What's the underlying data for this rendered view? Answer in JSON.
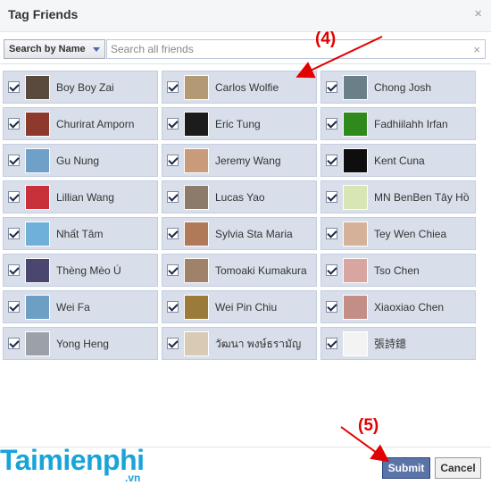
{
  "dialog": {
    "title": "Tag Friends",
    "close": "×"
  },
  "search": {
    "filter_label": "Search by Name",
    "placeholder": "Search all friends",
    "clear": "×"
  },
  "friends": [
    {
      "name": "Boy Boy Zai",
      "checked": true,
      "avatar_color": "#5a4a3e"
    },
    {
      "name": "Carlos Wolfie",
      "checked": true,
      "avatar_color": "#b49a74"
    },
    {
      "name": "Chong Josh",
      "checked": true,
      "avatar_color": "#6b7f88"
    },
    {
      "name": "Churirat Amporn",
      "checked": true,
      "avatar_color": "#8d3a2c"
    },
    {
      "name": "Eric Tung",
      "checked": true,
      "avatar_color": "#1c1c1c"
    },
    {
      "name": "Fadhiilahh Irfan",
      "checked": true,
      "avatar_color": "#2f8a1c"
    },
    {
      "name": "Gu Nung",
      "checked": true,
      "avatar_color": "#6ea0c8"
    },
    {
      "name": "Jeremy Wang",
      "checked": true,
      "avatar_color": "#c99b7a"
    },
    {
      "name": "Kent Cuna",
      "checked": true,
      "avatar_color": "#0e0e0e"
    },
    {
      "name": "Lillian Wang",
      "checked": true,
      "avatar_color": "#c8303a"
    },
    {
      "name": "Lucas Yao",
      "checked": true,
      "avatar_color": "#8c7a6a"
    },
    {
      "name": "MN BenBen Tây Hồ",
      "checked": true,
      "avatar_color": "#d7e6b2"
    },
    {
      "name": "Nhất Tâm",
      "checked": true,
      "avatar_color": "#6fb0d8"
    },
    {
      "name": "Sylvia Sta Maria",
      "checked": true,
      "avatar_color": "#b07a58"
    },
    {
      "name": "Tey Wen Chiea",
      "checked": true,
      "avatar_color": "#d6b19a"
    },
    {
      "name": "Thèng Mèo Ú",
      "checked": true,
      "avatar_color": "#4a4670"
    },
    {
      "name": "Tomoaki Kumakura",
      "checked": true,
      "avatar_color": "#a0826a"
    },
    {
      "name": "Tso Chen",
      "checked": true,
      "avatar_color": "#d8a5a0"
    },
    {
      "name": "Wei Fa",
      "checked": true,
      "avatar_color": "#6d9ec4"
    },
    {
      "name": "Wei Pin Chiu",
      "checked": true,
      "avatar_color": "#9c7a3a"
    },
    {
      "name": "Xiaoxiao Chen",
      "checked": true,
      "avatar_color": "#c48e86"
    },
    {
      "name": "Yong Heng",
      "checked": true,
      "avatar_color": "#9ca1a8"
    },
    {
      "name": "วัฒนา พงษ์ธรามัญ",
      "checked": true,
      "avatar_color": "#d9cab3"
    },
    {
      "name": "張詩鐿",
      "checked": true,
      "avatar_color": "#f3f3f3"
    }
  ],
  "footer": {
    "submit_label": "Submit",
    "cancel_label": "Cancel"
  },
  "annotations": {
    "step4": "(4)",
    "step5": "(5)"
  },
  "watermark": {
    "brand": "Taimienphi",
    "domain": ".vn"
  },
  "colors": {
    "accent": "#5b74a8",
    "annotation": "#e20000",
    "watermark": "#19a4d9"
  }
}
